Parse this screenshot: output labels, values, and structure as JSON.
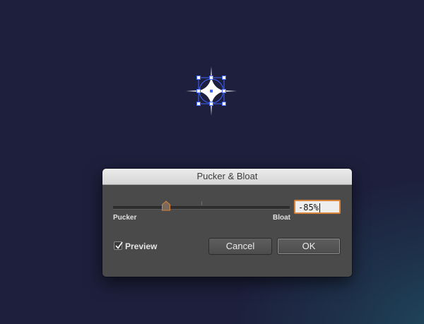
{
  "dialog": {
    "title": "Pucker & Bloat",
    "slider": {
      "left_label": "Pucker",
      "right_label": "Bloat",
      "value": -85,
      "min": -200,
      "max": 200
    },
    "value_field": "-85%",
    "preview_label": "Preview",
    "preview_checked": true,
    "cancel_label": "Cancel",
    "ok_label": "OK"
  },
  "colors": {
    "canvas_bg": "#1d1f3c",
    "selection_blue": "#3f63ff",
    "focus_ring": "#d9843a"
  },
  "icons": [
    "star-shape",
    "checkmark-icon",
    "slider-thumb-icon"
  ]
}
